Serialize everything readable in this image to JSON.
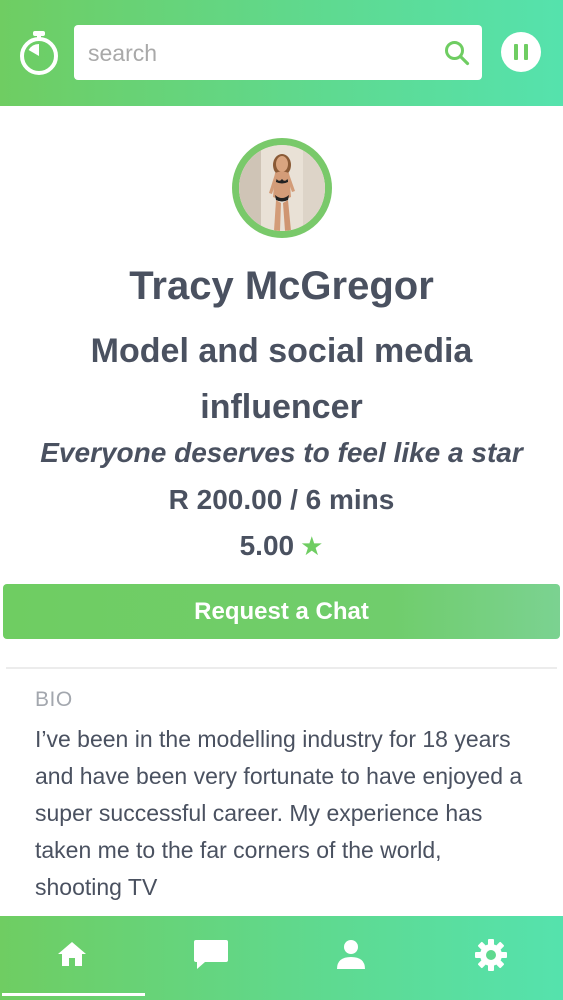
{
  "search": {
    "placeholder": "search"
  },
  "profile": {
    "name": "Tracy McGregor",
    "headline": "Model and social media influencer",
    "tagline": "Everyone deserves to feel like a star",
    "rate": "R 200.00 / 6 mins",
    "rating": "5.00",
    "rating_icon": "star-icon"
  },
  "actions": {
    "request_chat_label": "Request a Chat"
  },
  "bio": {
    "label": "BIO",
    "text": "I’ve been in the modelling industry for 18 years and have been very fortunate to have enjoyed a super successful career. My experience has taken me to the far corners of the world, shooting TV"
  },
  "nav": {
    "items": [
      {
        "icon": "home-icon",
        "active": true
      },
      {
        "icon": "chat-icon",
        "active": false
      },
      {
        "icon": "user-icon",
        "active": false
      },
      {
        "icon": "gear-icon",
        "active": false
      }
    ]
  },
  "colors": {
    "accent": "#6fcd62",
    "accent_end": "#55e2ad",
    "text": "#4a5160",
    "muted": "#a3a7ae"
  }
}
